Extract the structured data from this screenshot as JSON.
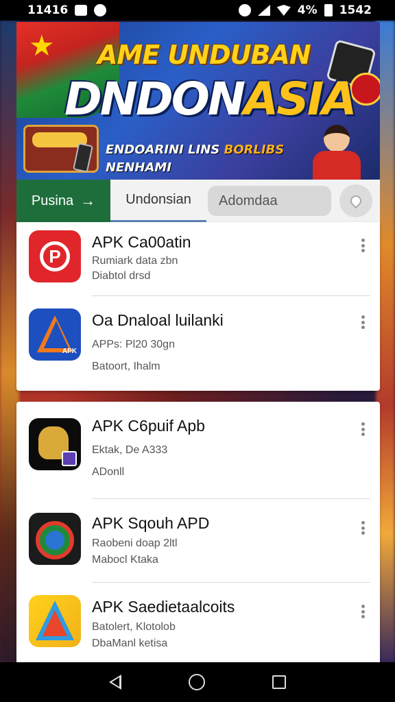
{
  "status_bar": {
    "time_left": "11416",
    "battery_text": "4%",
    "time_right": "1542"
  },
  "banner": {
    "title_line1": "AME UNDUBAN",
    "title_line2_white": "DNDON",
    "title_line2_yellow": "ASIA",
    "subtitle1_white": "ENDOARINI LINS ",
    "subtitle1_yellow": "BORLIBS",
    "subtitle2": "NENHAMI"
  },
  "tabs": {
    "active_label": "Pusina",
    "second_label": "Undonsian",
    "search_placeholder": "Adomdaa"
  },
  "apps": [
    {
      "title": "APK Ca00atin",
      "line1": "Rumiark data zbn",
      "line2": "Diabtol drsd"
    },
    {
      "title": "Oa Dnaloal luilanki",
      "line1": "APPs: Pl20 30gn",
      "line2": "Batoort, Ihalm"
    },
    {
      "title": "APK C6puif Apb",
      "line1": "Ektak, De A333",
      "line2": "ADonll"
    },
    {
      "title": "APK Sqouh APD",
      "line1": "Raobeni doap 2ltl",
      "line2": "Mabocl Ktaka"
    },
    {
      "title": "APK Saedietaalcoits",
      "line1": "Batolert, Klotolob",
      "line2": "DbaManl ketisa"
    }
  ],
  "icons": {
    "app1": "red-p-icon",
    "app2": "blue-a-icon",
    "app3": "garuda-icon",
    "app4": "green-ring-icon",
    "app5": "rainbow-a-icon"
  },
  "colors": {
    "active_tab": "#1e6e3c",
    "card_bg": "#ffffff"
  }
}
